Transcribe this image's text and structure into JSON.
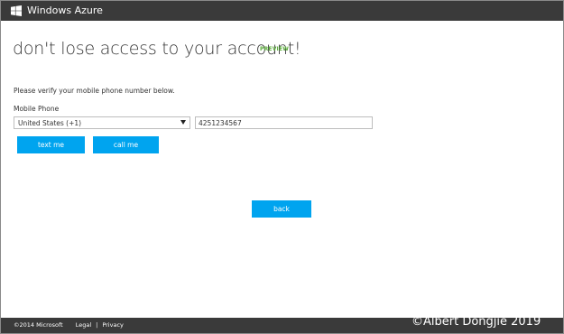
{
  "header": {
    "brand": "Windows Azure",
    "logo_icon": "windows-logo-icon"
  },
  "main": {
    "title": "don't lose access to your account!",
    "badge": "PREVIEW",
    "instruction": "Please verify your mobile phone number below.",
    "phone_label": "Mobile Phone",
    "country_selected": "United States (+1)",
    "phone_value": "4251234567",
    "text_button": "text me",
    "call_button": "call me",
    "back_button": "back"
  },
  "footer": {
    "copyright": "©2014 Microsoft",
    "separator": "|",
    "legal": "Legal",
    "privacy": "Privacy"
  },
  "watermark": "©Albert Dongjie  2019",
  "colors": {
    "accent": "#00a4ef",
    "bar": "#3a3a3a",
    "badge": "#5cae3c"
  }
}
